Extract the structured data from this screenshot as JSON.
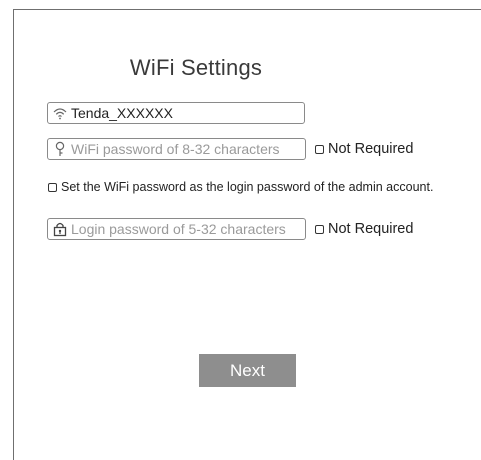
{
  "page": {
    "title": "WiFi Settings"
  },
  "wifi_name": {
    "value": "Tenda_XXXXXX"
  },
  "wifi_password": {
    "placeholder": "WiFi password of 8-32 characters",
    "not_required_label": "Not Required"
  },
  "same_password_option": {
    "label": "Set the WiFi password as the login password of the admin account."
  },
  "login_password": {
    "placeholder": "Login password of 5-32 characters",
    "not_required_label": "Not Required"
  },
  "actions": {
    "next_label": "Next"
  },
  "colors": {
    "button_bg": "#8e8e8e",
    "border": "#8a8a8a",
    "placeholder": "#9a9a9a"
  }
}
